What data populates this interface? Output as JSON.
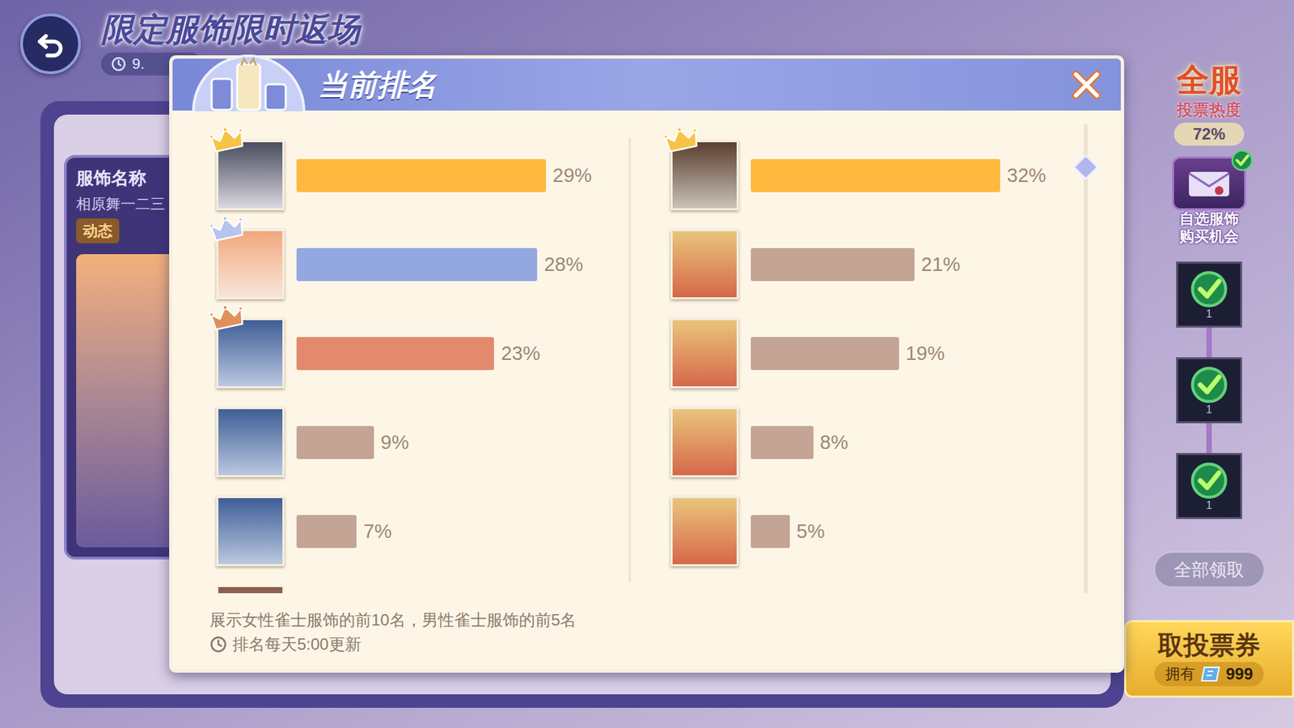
{
  "page": {
    "title": "限定服饰限时返场",
    "timer": "9."
  },
  "outfit_card": {
    "label": "服饰名称",
    "name": "相原舞一二三",
    "tag": "动态"
  },
  "side_panel": {
    "title": "全服",
    "subtitle": "投票热度",
    "heat": "72%",
    "bonus": {
      "label": "自选服饰购买机会",
      "claimed": true
    },
    "rewards": [
      {
        "count": "1",
        "claimed": true
      },
      {
        "count": "1",
        "claimed": true
      },
      {
        "count": "1",
        "claimed": true
      }
    ],
    "claim_all": {
      "label": "全部领取",
      "disabled": true
    },
    "tickets": {
      "label": "取投票券",
      "owned_label": "拥有",
      "owned": "999"
    }
  },
  "dialog": {
    "title": "当前排名",
    "female_ranking": [
      {
        "percent": "29%",
        "level": 0.29,
        "color": "#ffb83e",
        "crown": true,
        "crown_color": "#f5c446"
      },
      {
        "percent": "28%",
        "level": 0.28,
        "color": "#93a7e1",
        "crown": true,
        "crown_color": "#b8c4ec"
      },
      {
        "percent": "23%",
        "level": 0.23,
        "color": "#e3896d",
        "crown": true,
        "crown_color": "#e0905a"
      },
      {
        "percent": "9%",
        "level": 0.09,
        "color": "#c4a595",
        "crown": false
      },
      {
        "percent": "7%",
        "level": 0.07,
        "color": "#c4a595",
        "crown": false
      }
    ],
    "male_ranking": [
      {
        "percent": "32%",
        "level": 0.32,
        "color": "#ffb83e",
        "crown": true,
        "crown_color": "#f5c446"
      },
      {
        "percent": "21%",
        "level": 0.21,
        "color": "#c4a595",
        "crown": false
      },
      {
        "percent": "19%",
        "level": 0.19,
        "color": "#c4a595",
        "crown": false
      },
      {
        "percent": "8%",
        "level": 0.08,
        "color": "#c4a595",
        "crown": false
      },
      {
        "percent": "5%",
        "level": 0.05,
        "color": "#c4a595",
        "crown": false
      }
    ],
    "notes": [
      "展示女性雀士服饰的前10名，男性雀士服饰的前5名",
      "排名每天5:00更新"
    ]
  }
}
